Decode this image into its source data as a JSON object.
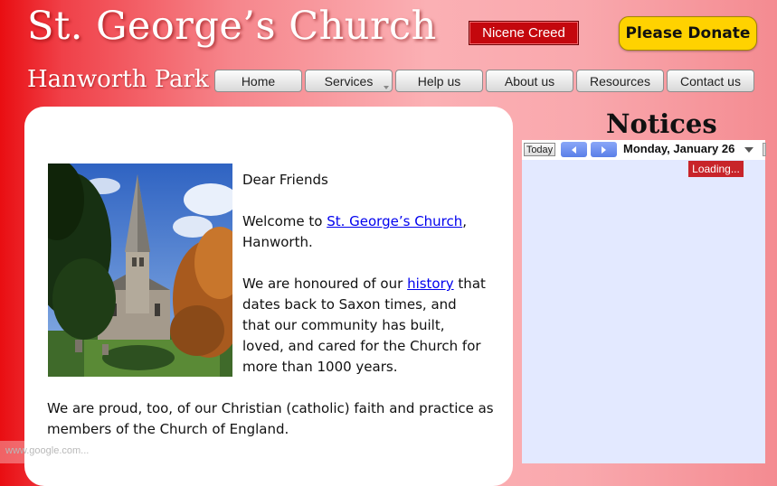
{
  "site": {
    "title": "St. George’s Church",
    "subtitle": "Hanworth Park"
  },
  "header": {
    "creed_label": "Nicene Creed",
    "donate_label": "Please Donate"
  },
  "nav": {
    "items": [
      {
        "label": "Home"
      },
      {
        "label": "Services",
        "has_submenu": true
      },
      {
        "label": "Help us"
      },
      {
        "label": "About us"
      },
      {
        "label": "Resources"
      },
      {
        "label": "Contact us"
      }
    ]
  },
  "main": {
    "greeting": "Dear Friends",
    "welcome_prefix": "Welcome to ",
    "welcome_link": "St. George’s Church",
    "welcome_suffix": ", Hanworth.",
    "history_prefix": "We are honoured of our ",
    "history_link": "history",
    "history_suffix": " that dates back to Saxon times, and that our community has built, loved, and cared for the Church for more than 1000 years.",
    "faith_text": "We are proud, too, of our Christian (catholic) faith and practice as members of the Church of England."
  },
  "notices": {
    "title": "Notices",
    "today_label": "Today",
    "date_label": "Monday, January 26",
    "loading_label": "Loading..."
  },
  "status": {
    "text": "www.google.com..."
  },
  "colors": {
    "creed_button": "#c4070d",
    "donate_button": "#ffd200",
    "calendar_bg": "#e3e9ff",
    "link": "#0000ee"
  }
}
